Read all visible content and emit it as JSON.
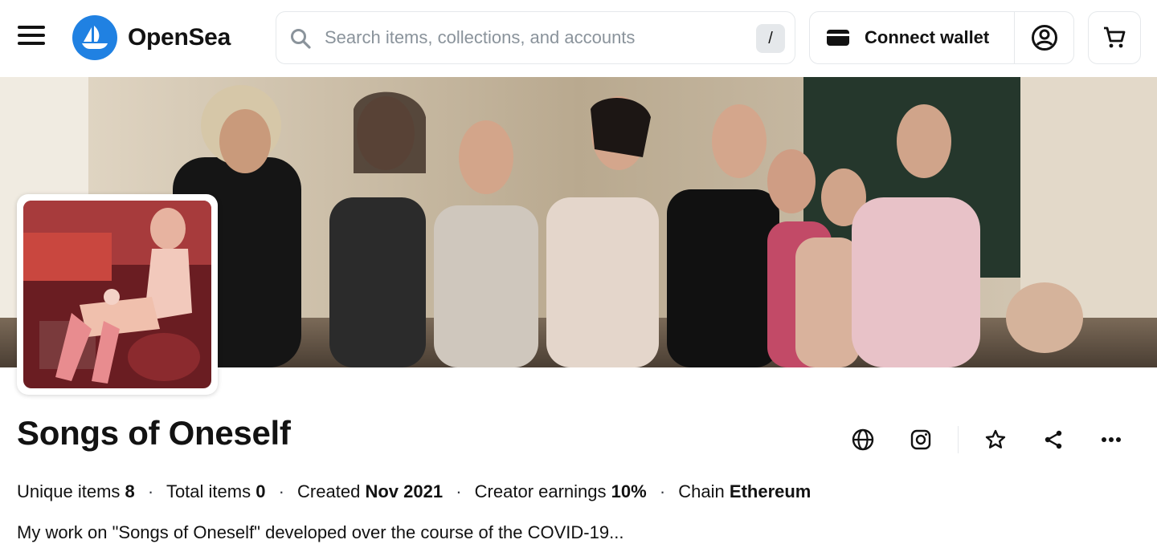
{
  "header": {
    "logo_text": "OpenSea",
    "search_placeholder": "Search items, collections, and accounts",
    "search_shortcut": "/",
    "connect_wallet_label": "Connect wallet"
  },
  "collection": {
    "name": "Songs of Oneself",
    "stats": {
      "unique_items_label": "Unique items",
      "unique_items_value": "8",
      "total_items_label": "Total items",
      "total_items_value": "0",
      "created_label": "Created",
      "created_value": "Nov 2021",
      "creator_earnings_label": "Creator earnings",
      "creator_earnings_value": "10%",
      "chain_label": "Chain",
      "chain_value": "Ethereum"
    },
    "description": "My work on \"Songs of Oneself\" developed over the course of the COVID-19..."
  },
  "icons": [
    "menu-icon",
    "opensea-logo-icon",
    "search-icon",
    "wallet-icon",
    "profile-icon",
    "cart-icon",
    "globe-icon",
    "instagram-icon",
    "star-icon",
    "share-icon",
    "more-icon"
  ],
  "colors": {
    "brand": "#2081e2",
    "text": "#121212",
    "border": "#e5e8eb",
    "placeholder": "#8a939b"
  }
}
